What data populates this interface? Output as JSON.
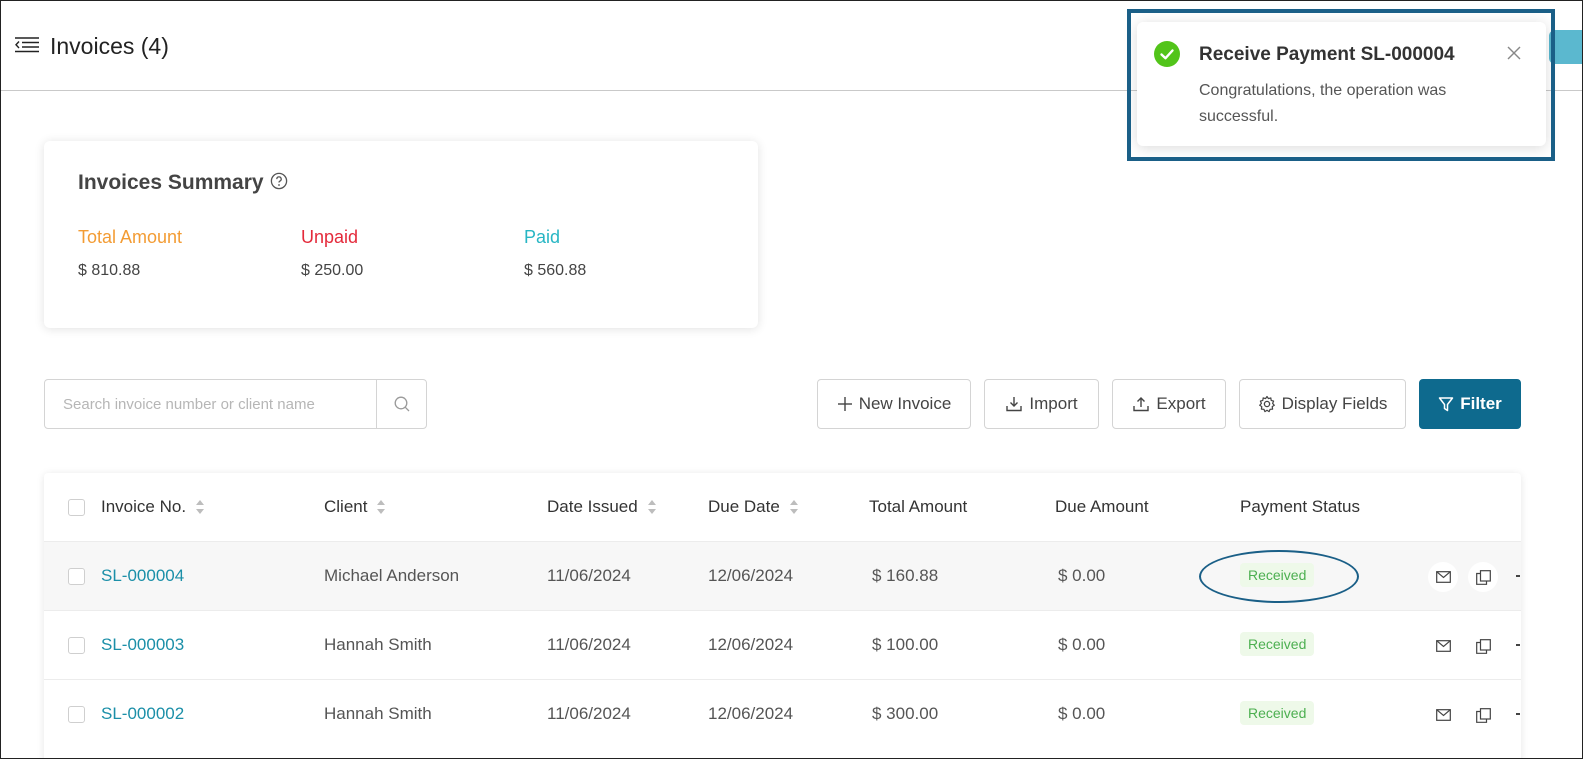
{
  "header": {
    "title": "Invoices (4)"
  },
  "summary": {
    "title": "Invoices Summary",
    "stats": [
      {
        "label": "Total Amount",
        "value": "$ 810.88",
        "color": "#f39c34"
      },
      {
        "label": "Unpaid",
        "value": "$ 250.00",
        "color": "#e42a3b"
      },
      {
        "label": "Paid",
        "value": "$ 560.88",
        "color": "#27b6c4"
      }
    ]
  },
  "toolbar": {
    "search_placeholder": "Search invoice number or client name",
    "new_invoice": "New Invoice",
    "import": "Import",
    "export": "Export",
    "display_fields": "Display Fields",
    "filter": "Filter"
  },
  "table": {
    "columns": [
      "Invoice No.",
      "Client",
      "Date Issued",
      "Due Date",
      "Total Amount",
      "Due Amount",
      "Payment Status"
    ],
    "rows": [
      {
        "invoice": "SL-000004",
        "client": "Michael Anderson",
        "issued": "11/06/2024",
        "due": "12/06/2024",
        "total": "$ 160.88",
        "due_amount": "$ 0.00",
        "status": "Received"
      },
      {
        "invoice": "SL-000003",
        "client": "Hannah Smith",
        "issued": "11/06/2024",
        "due": "12/06/2024",
        "total": "$ 100.00",
        "due_amount": "$ 0.00",
        "status": "Received"
      },
      {
        "invoice": "SL-000002",
        "client": "Hannah Smith",
        "issued": "11/06/2024",
        "due": "12/06/2024",
        "total": "$ 300.00",
        "due_amount": "$ 0.00",
        "status": "Received"
      }
    ]
  },
  "toast": {
    "title": "Receive Payment SL-000004",
    "message": "Congratulations, the operation was successful."
  },
  "colors": {
    "accent": "#0e6a8e",
    "link": "#1b8fa8",
    "status_received": "#4caf50",
    "annotation": "#1a5f87"
  }
}
